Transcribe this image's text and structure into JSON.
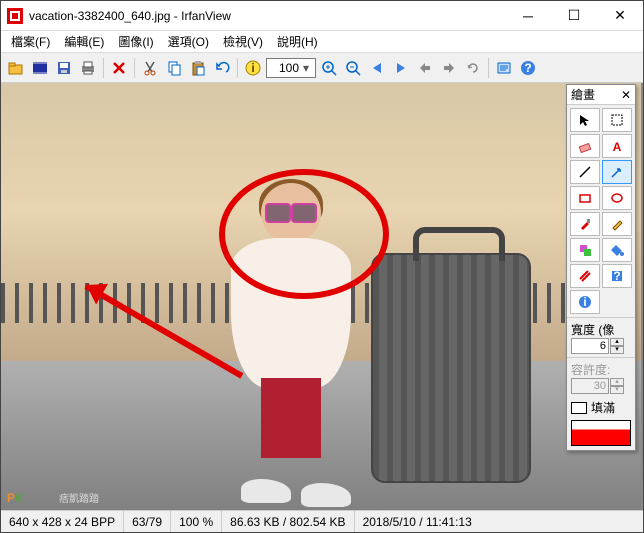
{
  "title": "vacation-3382400_640.jpg - IrfanView",
  "menu": [
    "檔案(F)",
    "編輯(E)",
    "圖像(I)",
    "選項(O)",
    "檢視(V)",
    "說明(H)"
  ],
  "toolbar": {
    "zoom_value": "100"
  },
  "status": {
    "dims": "640 x 428 x 24 BPP",
    "index": "63/79",
    "zoom": "100 %",
    "size": "86.63 KB / 802.54 KB",
    "date": "2018/5/10 / 11:41:13"
  },
  "palette": {
    "title": "繪畫",
    "width_label": "寬度 (像",
    "width_value": "6",
    "tol_label": "容許度:",
    "tol_value": "30",
    "fill_label": "填滿"
  },
  "watermark": {
    "p": "P",
    "k": "K",
    "sub": "痞凱踏踏"
  }
}
